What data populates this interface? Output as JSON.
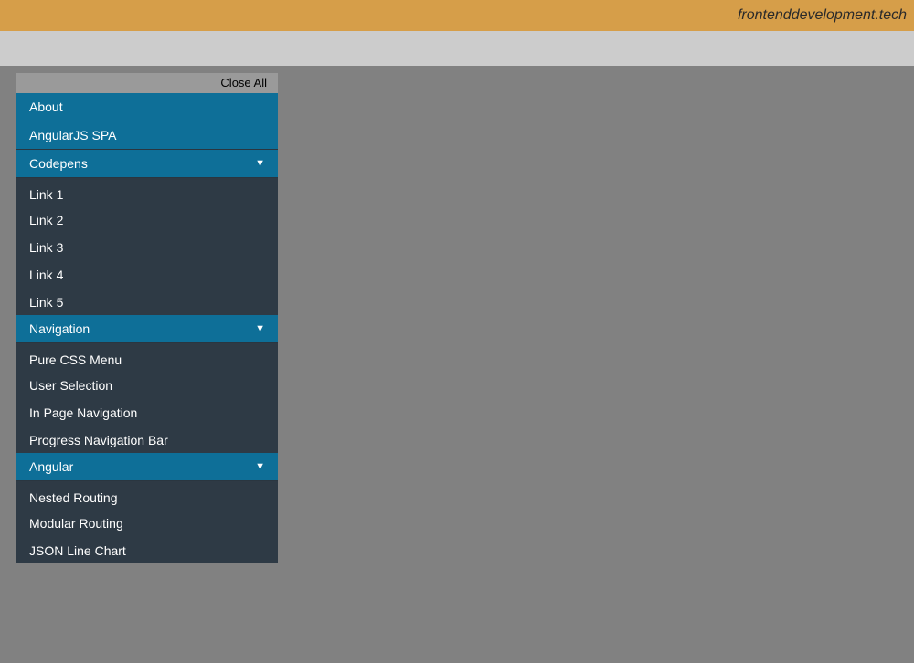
{
  "banner": {
    "site_name": "frontenddevelopment.tech"
  },
  "sidebar": {
    "close_all": "Close All",
    "items": [
      {
        "label": "About",
        "type": "link"
      },
      {
        "label": "AngularJS SPA",
        "type": "link"
      },
      {
        "label": "Codepens",
        "type": "section",
        "children": [
          {
            "label": "Link 1"
          },
          {
            "label": "Link 2"
          },
          {
            "label": "Link 3"
          },
          {
            "label": "Link 4"
          },
          {
            "label": "Link 5"
          }
        ]
      },
      {
        "label": "Navigation",
        "type": "section",
        "children": [
          {
            "label": "Pure CSS Menu"
          },
          {
            "label": "User Selection"
          },
          {
            "label": "In Page Navigation"
          },
          {
            "label": "Progress Navigation Bar"
          }
        ]
      },
      {
        "label": "Angular",
        "type": "section",
        "children": [
          {
            "label": "Nested Routing"
          },
          {
            "label": "Modular Routing"
          },
          {
            "label": "JSON Line Chart"
          }
        ]
      }
    ]
  }
}
